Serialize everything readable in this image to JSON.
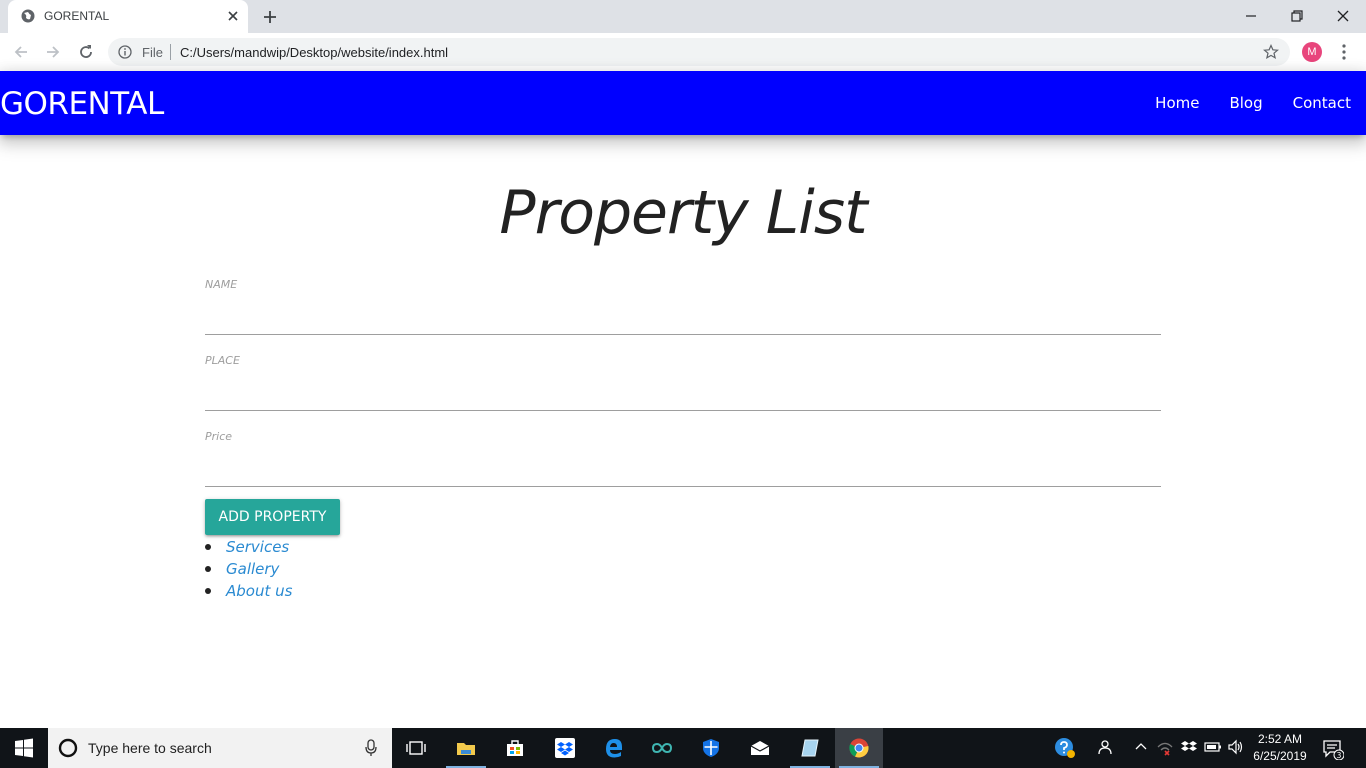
{
  "browser": {
    "tab_title": "GORENTAL",
    "omnibox_scheme": "File",
    "url": "C:/Users/mandwip/Desktop/website/index.html",
    "profile_initial": "M",
    "accent_color": "#e8457c"
  },
  "site": {
    "brand": "GORENTAL",
    "nav_color": "#0000ff",
    "nav_links": [
      "Home",
      "Blog",
      "Contact"
    ]
  },
  "main": {
    "title": "Property List",
    "fields": [
      {
        "label": "NAME",
        "value": ""
      },
      {
        "label": "PLACE",
        "value": ""
      },
      {
        "label": "Price",
        "value": ""
      }
    ],
    "add_button": "ADD PROPERTY",
    "button_color": "#26a69a",
    "links": [
      "Services",
      "Gallery",
      "About us"
    ]
  },
  "taskbar": {
    "search_placeholder": "Type here to search",
    "time": "2:52 AM",
    "date": "6/25/2019",
    "notification_count": "3",
    "apps": [
      "task-view-icon",
      "file-explorer-icon",
      "store-icon",
      "dropbox-icon",
      "edge-icon",
      "arduino-icon",
      "defender-icon",
      "mail-icon",
      "notepad-icon",
      "chrome-icon"
    ]
  }
}
